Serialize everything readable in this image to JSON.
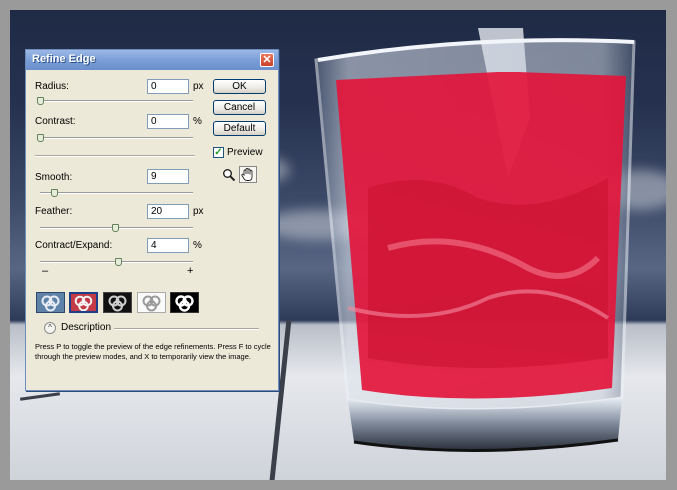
{
  "dialog": {
    "title": "Refine Edge",
    "close_glyph": "✕",
    "params": [
      {
        "label": "Radius:",
        "value": "0",
        "unit": "px",
        "slider": 0.0
      },
      {
        "label": "Contrast:",
        "value": "0",
        "unit": "%",
        "slider": 0.0
      },
      {
        "label": "Smooth:",
        "value": "9",
        "unit": "",
        "slider": 0.09
      },
      {
        "label": "Feather:",
        "value": "20",
        "unit": "px",
        "slider": 0.5
      },
      {
        "label": "Contract/Expand:",
        "value": "4",
        "unit": "%",
        "slider": 0.52
      }
    ],
    "minus": "–",
    "plus": "+",
    "buttons": {
      "ok": "OK",
      "cancel": "Cancel",
      "default": "Default"
    },
    "preview_label": "Preview",
    "preview_checked": true,
    "check_glyph": "✓",
    "modes": [
      "standard-mode-icon",
      "quick-mask-mode-icon",
      "on-black-mode-icon",
      "on-white-mode-icon",
      "mask-mode-icon"
    ],
    "description_label": "Description",
    "description_toggle": "^",
    "description_text": "Press P to toggle the preview of the edge refinements. Press F to cycle through the preview modes, and X to temporarily view the image."
  },
  "colors": {
    "mask_red": "#e3163c",
    "title_blue": "#7b9fd8",
    "dialog_bg": "#ece9d8"
  }
}
